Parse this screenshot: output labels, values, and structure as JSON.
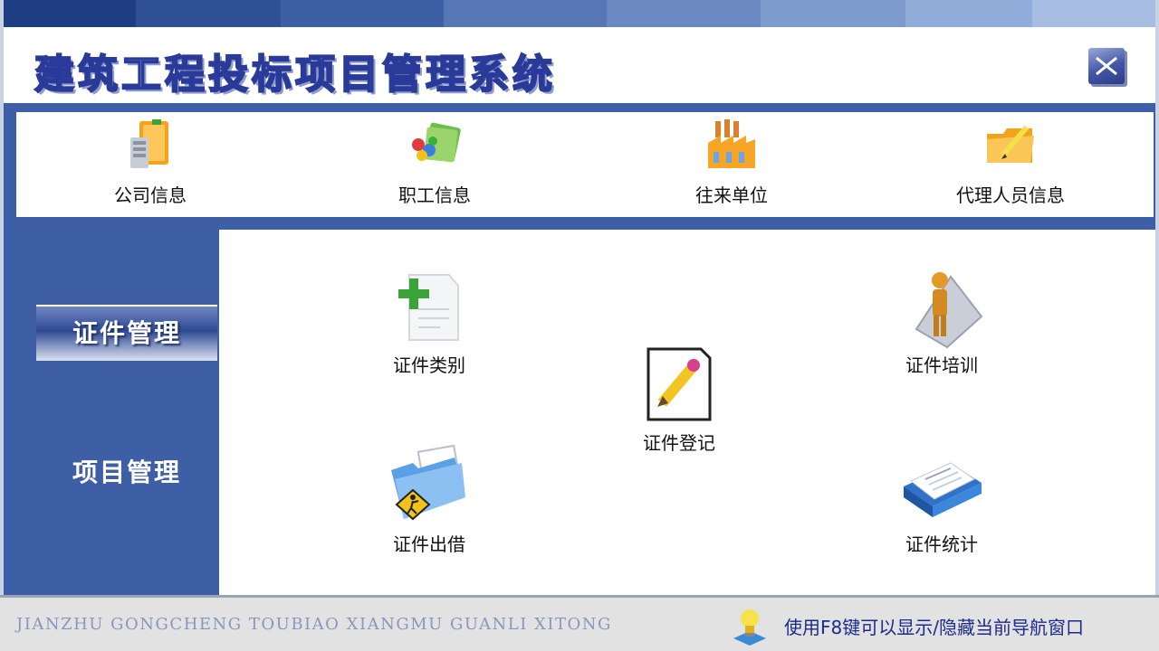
{
  "app": {
    "title": "建筑工程投标项目管理系统",
    "close_icon": "close-x-icon"
  },
  "top_nav": {
    "items": [
      {
        "label": "公司信息",
        "icon": "company-building-icon"
      },
      {
        "label": "职工信息",
        "icon": "people-folder-icon"
      },
      {
        "label": "往来单位",
        "icon": "factory-icon"
      },
      {
        "label": "代理人员信息",
        "icon": "folder-pencil-icon"
      }
    ]
  },
  "sidebar": {
    "items": [
      {
        "label": "证件管理",
        "active": true
      },
      {
        "label": "项目管理",
        "active": false
      }
    ]
  },
  "main": {
    "tiles": [
      {
        "label": "证件类别",
        "icon": "add-document-icon"
      },
      {
        "label": "证件登记",
        "icon": "edit-document-icon"
      },
      {
        "label": "证件培训",
        "icon": "person-document-icon"
      },
      {
        "label": "证件出借",
        "icon": "folder-caution-icon"
      },
      {
        "label": "证件统计",
        "icon": "report-book-icon"
      }
    ]
  },
  "footer": {
    "pinyin": "JIANZHU GONGCHENG TOUBIAO XIANGMU GUANLI XITONG",
    "hint": "使用F8键可以显示/隐藏当前导航窗口",
    "hint_icon": "lightbulb-icon"
  },
  "colors": {
    "accent_blue": "#3e5ea6",
    "title_outline": "#2a3a98",
    "hint_text": "#1c2b8c",
    "footer_bg": "#e2e2e2"
  }
}
